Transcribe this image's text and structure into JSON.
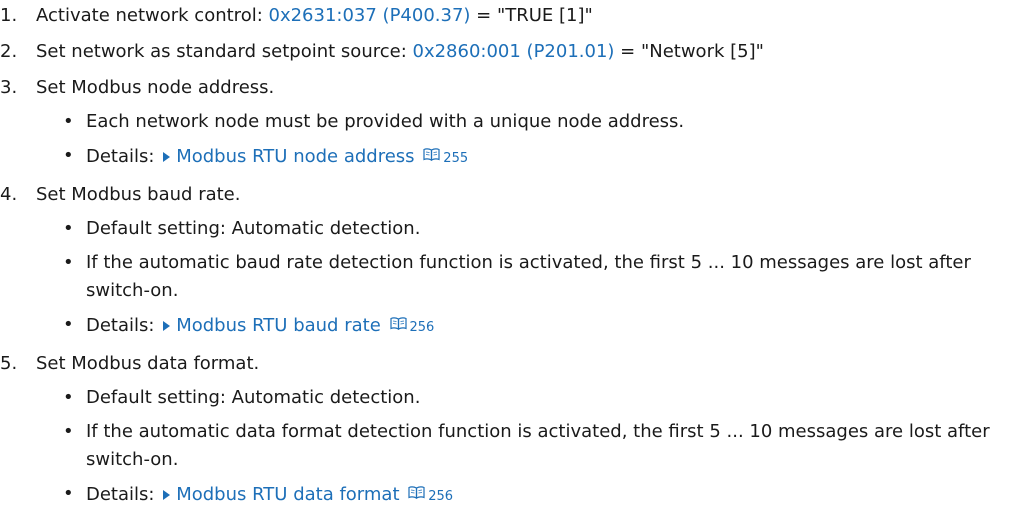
{
  "steps": [
    {
      "number": "1.",
      "text_before": "Activate network control: ",
      "link": "0x2631:037 (P400.37)",
      "text_after": " = \"TRUE [1]\""
    },
    {
      "number": "2.",
      "text_before": "Set network as standard setpoint source: ",
      "link": "0x2860:001 (P201.01)",
      "text_after": " = \"Network [5]\""
    },
    {
      "number": "3.",
      "text": "Set Modbus node address.",
      "bullets": [
        "Each network node must be provided with a unique node address."
      ],
      "details_label": "Details: ",
      "details_link": "Modbus RTU node address",
      "details_page": "255"
    },
    {
      "number": "4.",
      "text": "Set Modbus baud rate.",
      "bullets": [
        "Default setting: Automatic detection.",
        "If the automatic baud rate detection function is activated, the first 5 ... 10 messages are lost after switch-on."
      ],
      "details_label": "Details: ",
      "details_link": "Modbus RTU baud rate",
      "details_page": "256"
    },
    {
      "number": "5.",
      "text": "Set Modbus data format.",
      "bullets": [
        "Default setting: Automatic detection.",
        "If the automatic data format detection function is activated, the first 5 ... 10 messages are lost after switch-on."
      ],
      "details_label": "Details: ",
      "details_link": "Modbus RTU data format",
      "details_page": "256"
    }
  ],
  "bullet_char": "•",
  "colors": {
    "text": "#1a1a1a",
    "link": "#1d6fb8"
  }
}
